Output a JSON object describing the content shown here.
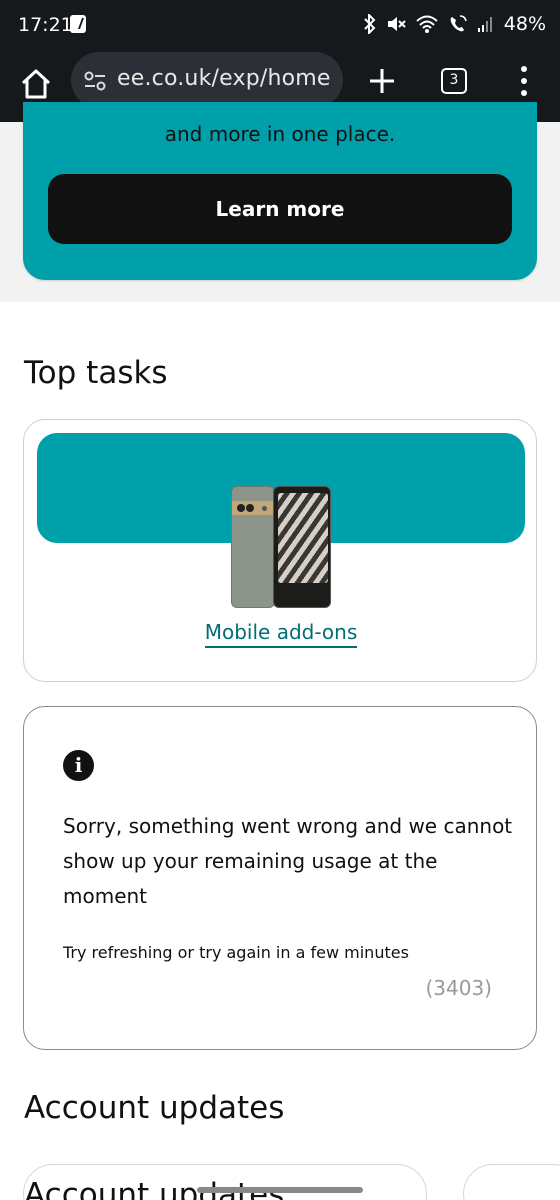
{
  "status_bar": {
    "time": "17:21",
    "battery": "48%",
    "icons": [
      "bluetooth-icon",
      "mute-icon",
      "wifi-icon",
      "wifi-call-icon",
      "signal-icon"
    ]
  },
  "browser": {
    "url": "ee.co.uk/exp/home",
    "tab_count": "3",
    "icons": [
      "home-icon",
      "site-settings-icon",
      "new-tab-icon",
      "tabs-icon",
      "more-menu-icon"
    ]
  },
  "promo": {
    "text": "and more in one place.",
    "button_label": "Learn more",
    "color": "#00a0aa"
  },
  "top_tasks": {
    "title": "Top tasks",
    "card_link": "Mobile add-ons"
  },
  "error": {
    "message": "Sorry, something went wrong and we cannot show up your remaining usage at the moment",
    "hint": "Try refreshing or try again in a few minutes",
    "code": "(3403)"
  },
  "account_updates": {
    "title": "Account updates",
    "ghost_text": "Account updates"
  }
}
